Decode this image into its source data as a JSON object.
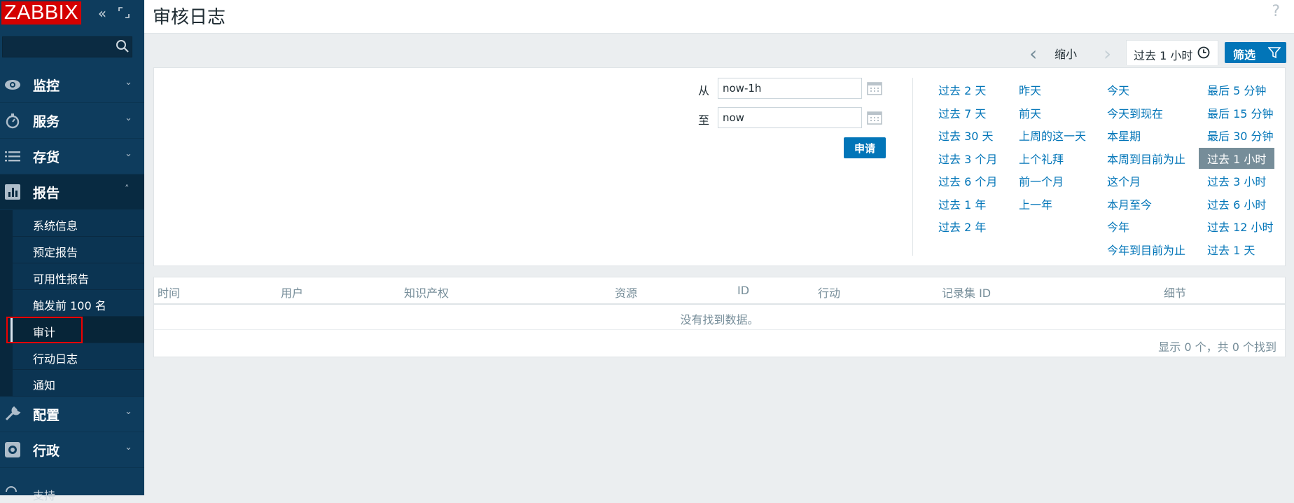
{
  "logo": "ZABBIX",
  "menu": {
    "items": [
      {
        "label": "监控",
        "icon": "eye-icon"
      },
      {
        "label": "服务",
        "icon": "stopwatch-icon"
      },
      {
        "label": "存货",
        "icon": "list-icon"
      },
      {
        "label": "报告",
        "icon": "bar-chart-icon"
      }
    ],
    "reports_sub": [
      "系统信息",
      "预定报告",
      "可用性报告",
      "触发前 100 名",
      "审计",
      "行动日志",
      "通知"
    ],
    "after": [
      {
        "label": "配置",
        "icon": "wrench-icon"
      },
      {
        "label": "行政",
        "icon": "gear-icon"
      }
    ],
    "support": "支持"
  },
  "header": {
    "title": "审核日志",
    "help": "?"
  },
  "toolbar": {
    "zoom_out": "缩小",
    "range": "过去 1 小时",
    "filter": "筛选"
  },
  "filter": {
    "from_label": "从",
    "from_value": "now-1h",
    "to_label": "至",
    "to_value": "now",
    "apply": "申请",
    "quick": {
      "col1": [
        "过去 2 天",
        "过去 7 天",
        "过去 30 天",
        "过去 3 个月",
        "过去 6 个月",
        "过去 1 年",
        "过去 2 年"
      ],
      "col2": [
        "昨天",
        "前天",
        "上周的这一天",
        "上个礼拜",
        "前一个月",
        "上一年"
      ],
      "col3": [
        "今天",
        "今天到现在",
        "本星期",
        "本周到目前为止",
        "这个月",
        "本月至今",
        "今年",
        "今年到目前为止"
      ],
      "col4": [
        "最后 5 分钟",
        "最后 15 分钟",
        "最后 30 分钟",
        "过去 1 小时",
        "过去 3 小时",
        "过去 6 小时",
        "过去 12 小时",
        "过去 1 天"
      ],
      "selected": "过去 1 小时"
    }
  },
  "table": {
    "headers": [
      "时间",
      "用户",
      "知识产权",
      "资源",
      "ID",
      "行动",
      "记录集 ID",
      "细节"
    ],
    "empty": "没有找到数据。",
    "footer": "显示 0 个，共 0 个找到"
  },
  "colors": {
    "sidebar": "#0e3c5d",
    "logo": "#d40000",
    "primary": "#0275b8",
    "selected_range": "#768d99"
  }
}
